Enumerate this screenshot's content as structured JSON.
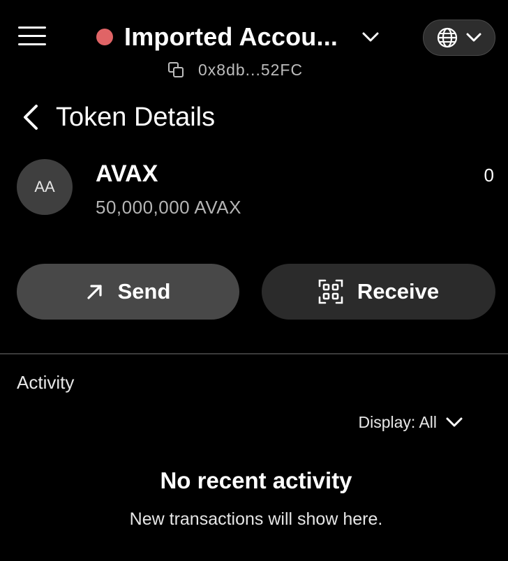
{
  "header": {
    "account_name": "Imported Accou...",
    "address": "0x8db...52FC",
    "status_color": "#e06466"
  },
  "page": {
    "title": "Token Details"
  },
  "token": {
    "avatar_initials": "AA",
    "symbol": "AVAX",
    "supply": "50,000,000 AVAX",
    "balance": "0"
  },
  "actions": {
    "send_label": "Send",
    "receive_label": "Receive"
  },
  "activity": {
    "section_label": "Activity",
    "display_filter": "Display: All",
    "empty_title": "No recent activity",
    "empty_subtitle": "New transactions will show here."
  },
  "icons": {
    "menu": "hamburger-menu-icon",
    "account_chevron": "chevron-down-icon",
    "copy": "copy-icon",
    "network": "globe-icon",
    "back": "chevron-left-icon",
    "send": "arrow-up-right-icon",
    "receive": "qr-code-icon",
    "filter": "chevron-down-icon"
  }
}
